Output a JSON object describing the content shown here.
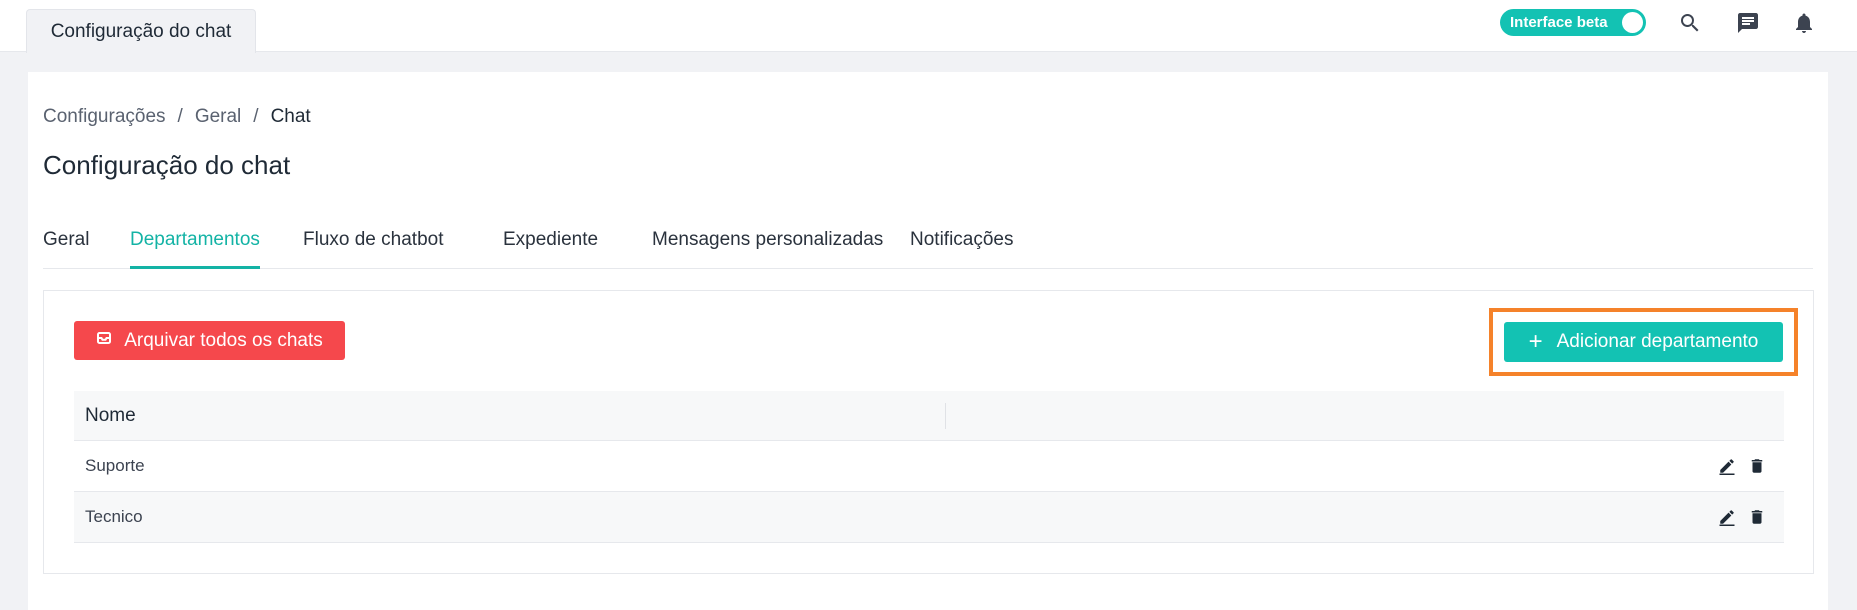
{
  "topbar": {
    "tab_label": "Configuração do chat",
    "beta_toggle_label": "Interface beta",
    "beta_toggle_on": true,
    "icons": [
      "search-icon",
      "chat-icon",
      "bell-icon"
    ]
  },
  "breadcrumb": {
    "items": [
      "Configurações",
      "Geral",
      "Chat"
    ],
    "separator": "/"
  },
  "page": {
    "title": "Configuração do chat"
  },
  "tabs": [
    {
      "label": "Geral",
      "active": false
    },
    {
      "label": "Departamentos",
      "active": true
    },
    {
      "label": "Fluxo de chatbot",
      "active": false
    },
    {
      "label": "Expediente",
      "active": false
    },
    {
      "label": "Mensagens personalizadas",
      "active": false
    },
    {
      "label": "Notificações",
      "active": false
    }
  ],
  "actions": {
    "archive_label": "Arquivar todos os chats",
    "add_label": "Adicionar departamento"
  },
  "table": {
    "columns": [
      "Nome",
      ""
    ],
    "rows": [
      {
        "name": "Suporte"
      },
      {
        "name": "Tecnico"
      }
    ]
  },
  "colors": {
    "accent": "#13c2b3",
    "danger": "#f5484c",
    "highlight": "#f5822a"
  }
}
